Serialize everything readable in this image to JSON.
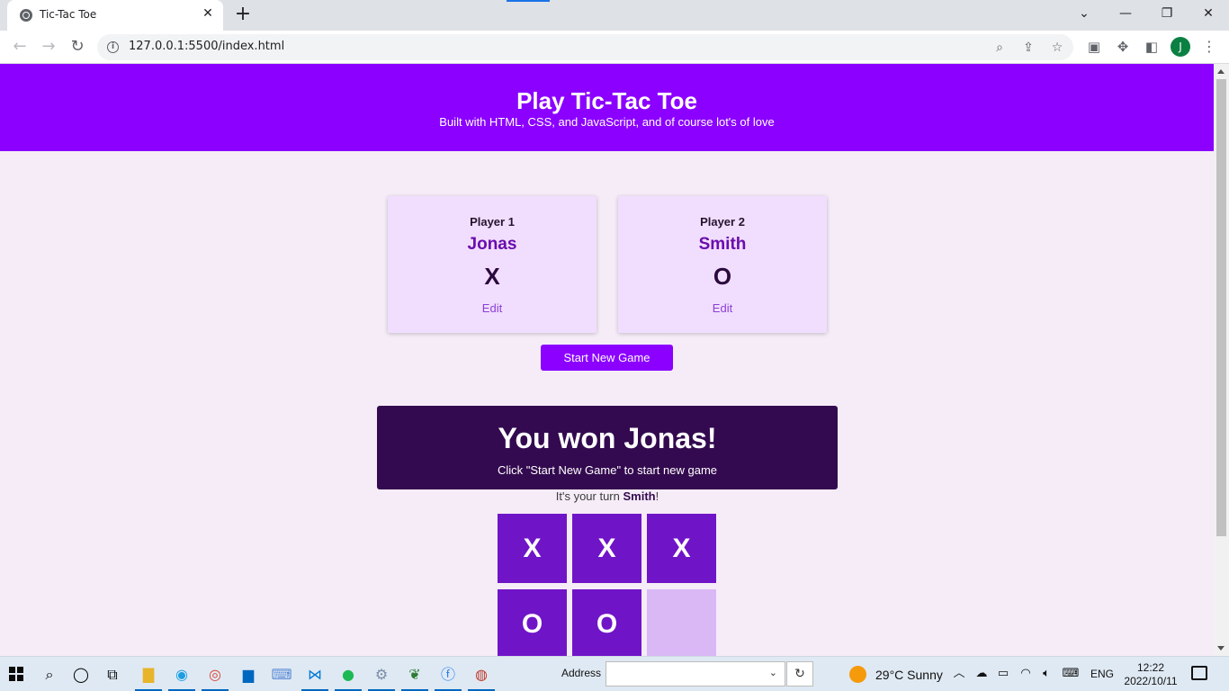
{
  "browser": {
    "tab_title": "Tic-Tac Toe",
    "tab_close": "✕",
    "new_tab": "+",
    "url": "127.0.0.1:5500/index.html",
    "profile_initial": "J"
  },
  "header": {
    "title": "Play Tic-Tac Toe",
    "subtitle": "Built with HTML, CSS, and JavaScript, and of course lot's of love"
  },
  "players": [
    {
      "label": "Player 1",
      "name": "Jonas",
      "symbol": "X",
      "edit": "Edit"
    },
    {
      "label": "Player 2",
      "name": "Smith",
      "symbol": "O",
      "edit": "Edit"
    }
  ],
  "start_button": "Start New Game",
  "game_over": {
    "title": "You won Jonas!",
    "message": "Click \"Start New Game\" to start new game"
  },
  "turn": {
    "prefix": "It's your turn ",
    "player": "Smith",
    "suffix": "!"
  },
  "board": {
    "cells": [
      "X",
      "X",
      "X",
      "O",
      "O",
      ""
    ]
  },
  "taskbar": {
    "address_label": "Address",
    "weather": "29°C  Sunny",
    "language": "ENG",
    "time": "12:22",
    "date": "2022/10/11"
  },
  "colors": {
    "header": "#8b00ff",
    "card": "#f1deff",
    "game_over_bg": "#330a4f",
    "cell": "#7014c8",
    "cell_empty": "#d9b8f5"
  }
}
